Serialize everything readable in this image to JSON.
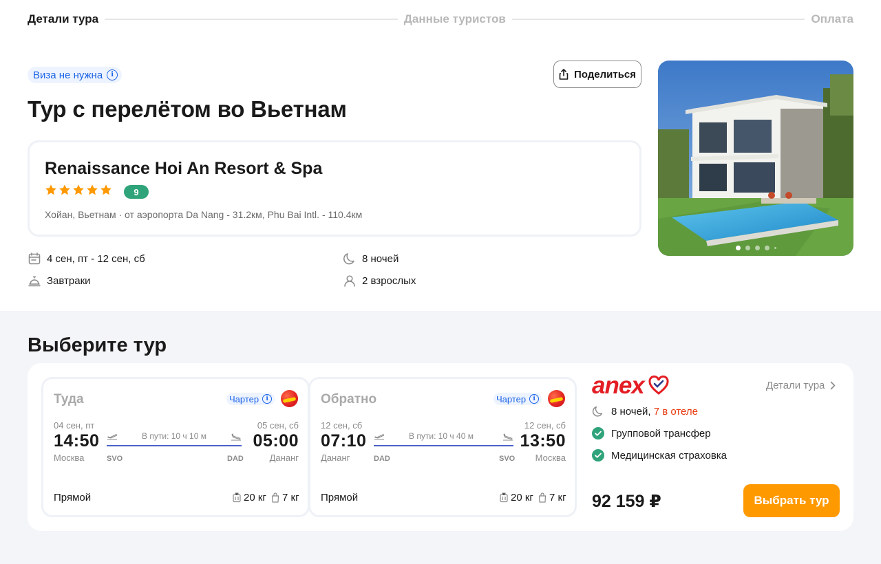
{
  "stepper": {
    "steps": [
      "Детали тура",
      "Данные туристов",
      "Оплата"
    ]
  },
  "header": {
    "visa_badge": "Виза не нужна",
    "share_label": "Поделиться",
    "title": "Тур с перелётом во Вьетнам"
  },
  "hotel": {
    "name": "Renaissance Hoi An Resort & Spa",
    "stars": 5,
    "rating": "9",
    "location": "Хойан, Вьетнам · от аэропорта Da Nang - 31.2км, Phu Bai Intl. - 110.4км"
  },
  "tour_info": {
    "dates": "4 сен, пт - 12 сен, сб",
    "nights": "8 ночей",
    "meals": "Завтраки",
    "guests": "2 взрослых"
  },
  "photo": {
    "slides": 5,
    "active_slide": 1
  },
  "select_section": {
    "title": "Выберите тур"
  },
  "flights": {
    "there": {
      "direction": "Туда",
      "charter": "Чартер",
      "dep_date": "04 сен, пт",
      "dep_time": "14:50",
      "dep_city": "Москва",
      "dep_code": "SVO",
      "duration": "В пути: 10 ч 10 м",
      "arr_date": "05 сен, сб",
      "arr_time": "05:00",
      "arr_city": "Дананг",
      "arr_code": "DAD",
      "type": "Прямой",
      "baggage": "20 кг",
      "hand": "7 кг"
    },
    "back": {
      "direction": "Обратно",
      "charter": "Чартер",
      "dep_date": "12 сен, сб",
      "dep_time": "07:10",
      "dep_city": "Дананг",
      "dep_code": "DAD",
      "duration": "В пути: 10 ч 40 м",
      "arr_date": "12 сен, сб",
      "arr_time": "13:50",
      "arr_city": "Москва",
      "arr_code": "SVO",
      "type": "Прямой",
      "baggage": "20 кг",
      "hand": "7 кг"
    }
  },
  "offer": {
    "operator": "anex",
    "details_link": "Детали тура",
    "nights": "8 ночей,",
    "in_hotel": "7 в отеле",
    "perk_transfer": "Групповой трансфер",
    "perk_insurance": "Медицинская страховка",
    "price": "92 159 ₽",
    "choose_label": "Выбрать тур"
  },
  "colors": {
    "accent_orange": "#ff9900",
    "anex_red": "#e31e24",
    "link_blue": "#1c64e6",
    "rating_green": "#2fa37a",
    "star": "#ff9900",
    "flight_line": "#4a63c9"
  }
}
